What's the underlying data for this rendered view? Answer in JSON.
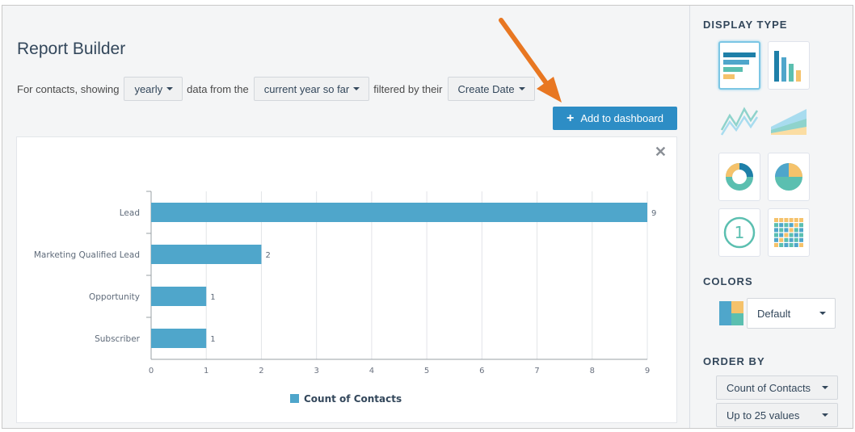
{
  "header": {
    "title": "Report Builder",
    "filter_prefix": "For contacts, showing",
    "frequency": "yearly",
    "data_from_text": "data from the",
    "range": "current year so far",
    "filtered_by_text": "filtered by their",
    "date_property": "Create Date",
    "add_button": "Add to dashboard"
  },
  "chart_data": {
    "type": "bar",
    "orientation": "horizontal",
    "categories": [
      "Lead",
      "Marketing Qualified Lead",
      "Opportunity",
      "Subscriber"
    ],
    "series": [
      {
        "name": "Count of Contacts",
        "values": [
          9,
          2,
          1,
          1
        ],
        "color": "#4fa6cb"
      }
    ],
    "x_ticks": [
      "0",
      "1",
      "2",
      "3",
      "4",
      "5",
      "6",
      "7",
      "8",
      "9"
    ],
    "xlim": [
      0,
      9
    ],
    "grid": true,
    "legend_position": "bottom-center"
  },
  "sidebar": {
    "display_type_heading": "DISPLAY TYPE",
    "display_types": [
      "horizontal-bar-chart-icon",
      "vertical-bar-chart-icon",
      "line-chart-icon",
      "area-chart-icon",
      "donut-chart-icon",
      "pie-chart-icon",
      "single-value-icon",
      "table-grid-icon"
    ],
    "single_value_glyph": "1",
    "colors_heading": "COLORS",
    "color_scheme": "Default",
    "order_by_heading": "ORDER BY",
    "order_by": "Count of Contacts",
    "limit": "Up to 25 values"
  },
  "colors": {
    "accent": "#2d8dc5",
    "bar": "#4fa6cb",
    "arrow": "#e87722",
    "teal": "#5bbfb0",
    "yellow": "#f5c26b",
    "blue": "#1e7fa8"
  }
}
